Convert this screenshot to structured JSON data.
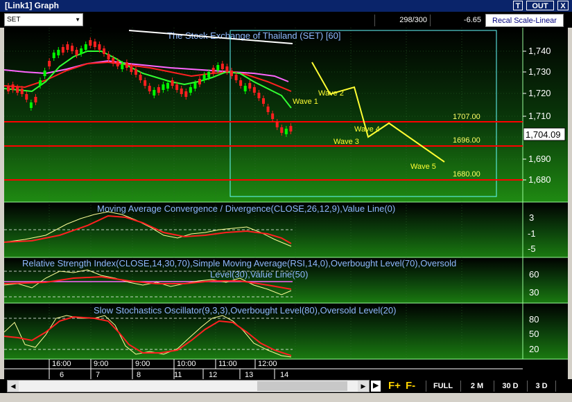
{
  "window": {
    "title": "[Link1] Graph",
    "buttons": [
      "T",
      "OUT",
      "X"
    ]
  },
  "toolbar": {
    "symbol": "SET",
    "count": "298/300",
    "change": "-6.65",
    "recal_button": "Recal Scale-Linear"
  },
  "main_chart": {
    "title": "The Stock Exchange of Thailand (SET) [60]",
    "price_axis": [
      "1,740",
      "1,730",
      "1,720",
      "1,710",
      "1,690",
      "1,680"
    ],
    "current_price": "1,704.09",
    "levels": [
      "1707.00",
      "1696.00",
      "1680.00"
    ],
    "waves": [
      "Wave 1",
      "Wave 2",
      "Wave 3",
      "Wave 4",
      "Wave 5"
    ]
  },
  "macd": {
    "title": "Moving Average Convergence / Divergence(CLOSE,26,12,9),Value Line(0)",
    "axis": [
      "3",
      "-1",
      "-5"
    ]
  },
  "rsi": {
    "title_line1": "Relative Strength Index(CLOSE,14,30,70),Simple Moving Average(RSI,14,0),Overbought Level(70),Oversold",
    "title_line2": "Level(30),Value Line(50)",
    "axis": [
      "60",
      "30"
    ]
  },
  "stoch": {
    "title": "Slow Stochastics Oscillator(9,3,3),Overbought Level(80),Oversold Level(20)",
    "axis": [
      "80",
      "50",
      "20"
    ]
  },
  "time_axis": {
    "times": [
      "16:00",
      "9:00",
      "9:00",
      "10:00",
      "11:00",
      "12:00"
    ],
    "dates": [
      "6",
      "7",
      "8",
      "11",
      "12",
      "13",
      "14"
    ]
  },
  "bottom": {
    "zoom_in": "F+",
    "zoom_out": "F-",
    "ranges": [
      "FULL",
      "2 M",
      "30 D",
      "3 D"
    ]
  },
  "colors": {
    "up": "#00ff00",
    "down": "#ff2020",
    "wave": "#ffff33",
    "level": "#ff0000",
    "frame": "#66ffff",
    "title": "#8fb8ff"
  }
}
